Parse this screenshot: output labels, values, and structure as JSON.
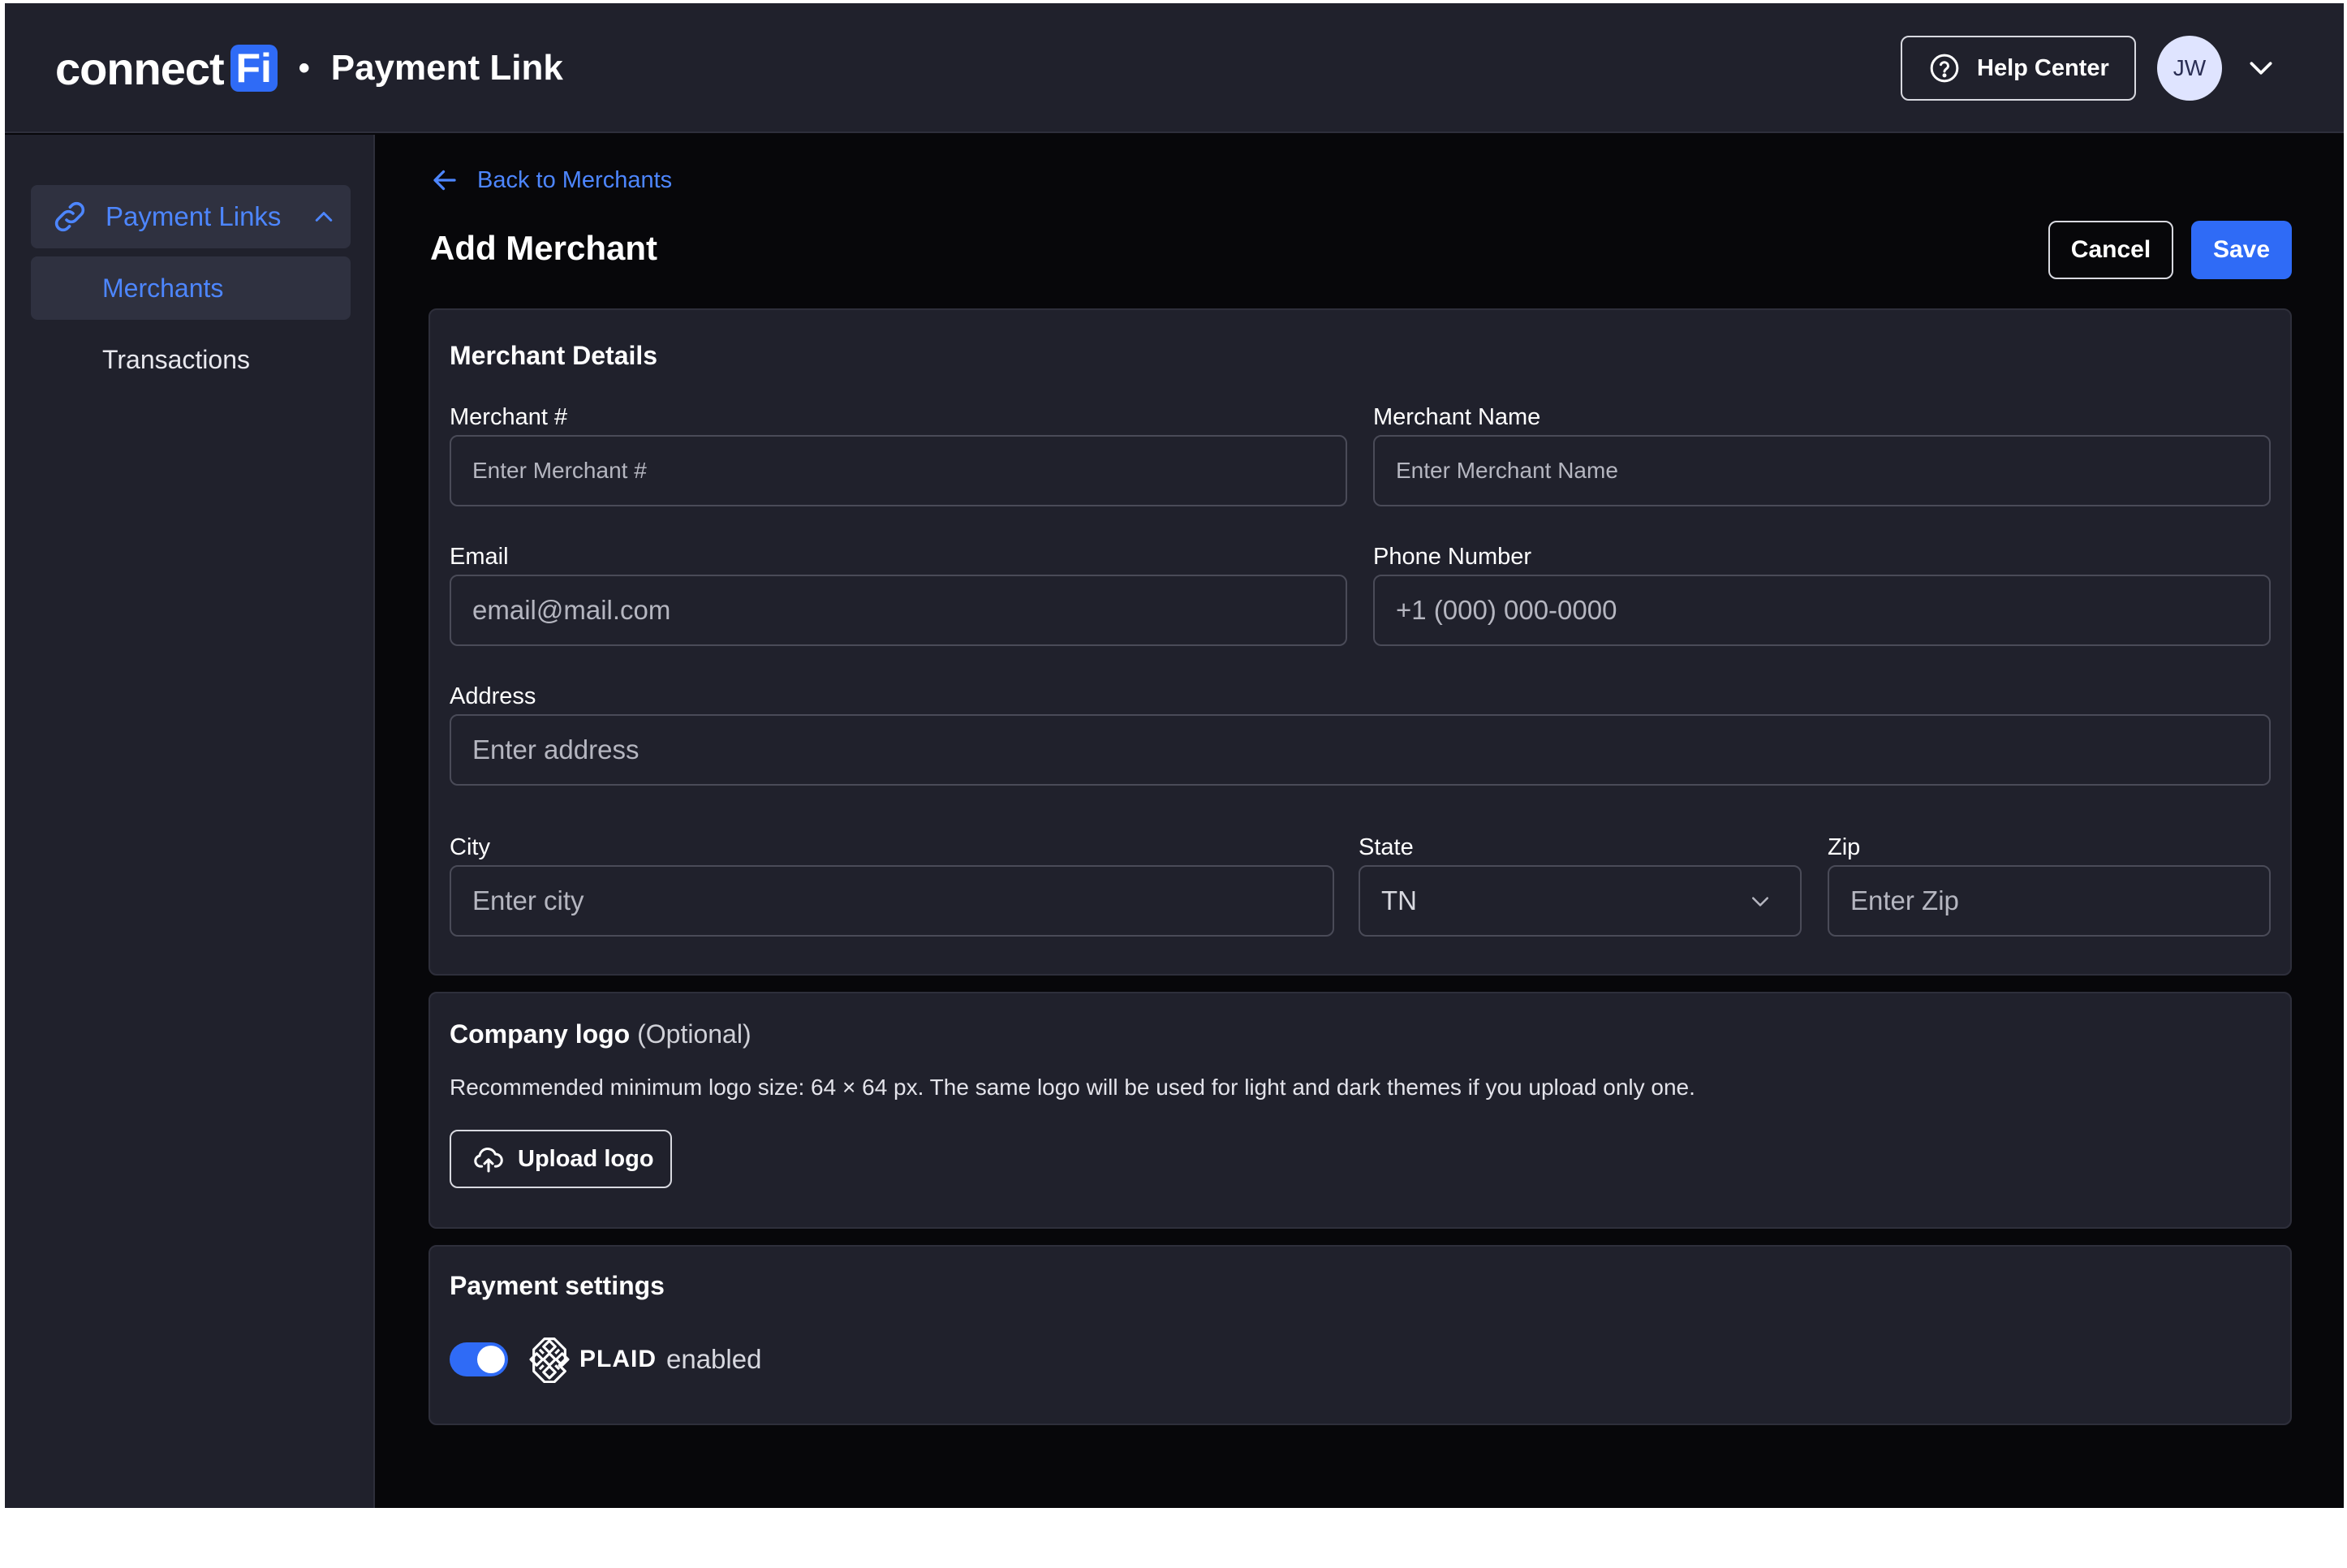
{
  "header": {
    "brand_connect": "connect",
    "brand_fi": "Fi",
    "separator": "•",
    "product": "Payment Link",
    "help_label": "Help Center",
    "avatar_initials": "JW"
  },
  "sidebar": {
    "parent_label": "Payment Links",
    "items": [
      {
        "label": "Merchants",
        "active": true
      },
      {
        "label": "Transactions",
        "active": false
      }
    ]
  },
  "page": {
    "back_label": "Back to Merchants",
    "title": "Add Merchant",
    "cancel_label": "Cancel",
    "save_label": "Save"
  },
  "merchant_details": {
    "title": "Merchant Details",
    "merchant_number": {
      "label": "Merchant #",
      "placeholder": "Enter Merchant #"
    },
    "merchant_name": {
      "label": "Merchant Name",
      "placeholder": "Enter Merchant Name"
    },
    "email": {
      "label": "Email",
      "placeholder": "email@mail.com"
    },
    "phone": {
      "label": "Phone Number",
      "placeholder": "+1 (000) 000-0000"
    },
    "address": {
      "label": "Address",
      "placeholder": "Enter address"
    },
    "city": {
      "label": "City",
      "placeholder": "Enter city"
    },
    "state": {
      "label": "State",
      "value": "TN"
    },
    "zip": {
      "label": "Zip",
      "placeholder": "Enter Zip"
    }
  },
  "company_logo": {
    "title": "Company logo",
    "optional": "(Optional)",
    "note": "Recommended minimum logo size: 64 × 64 px. The same logo will be used for light and dark themes if you upload only one.",
    "upload_label": "Upload logo"
  },
  "payment_settings": {
    "title": "Payment settings",
    "provider": "PLAID",
    "status": "enabled",
    "enabled": true
  },
  "colors": {
    "accent": "#2f6bf6",
    "link": "#4d86ff",
    "panel": "#20212c",
    "background": "#07070a"
  },
  "icons": {
    "help": "question-circle-icon",
    "user_menu": "chevron-down-icon",
    "nav": "link-icon",
    "nav_collapse": "chevron-up-icon",
    "back": "arrow-left-icon",
    "select": "chevron-down-icon",
    "upload": "cloud-upload-icon",
    "plaid": "plaid-logo-icon"
  }
}
